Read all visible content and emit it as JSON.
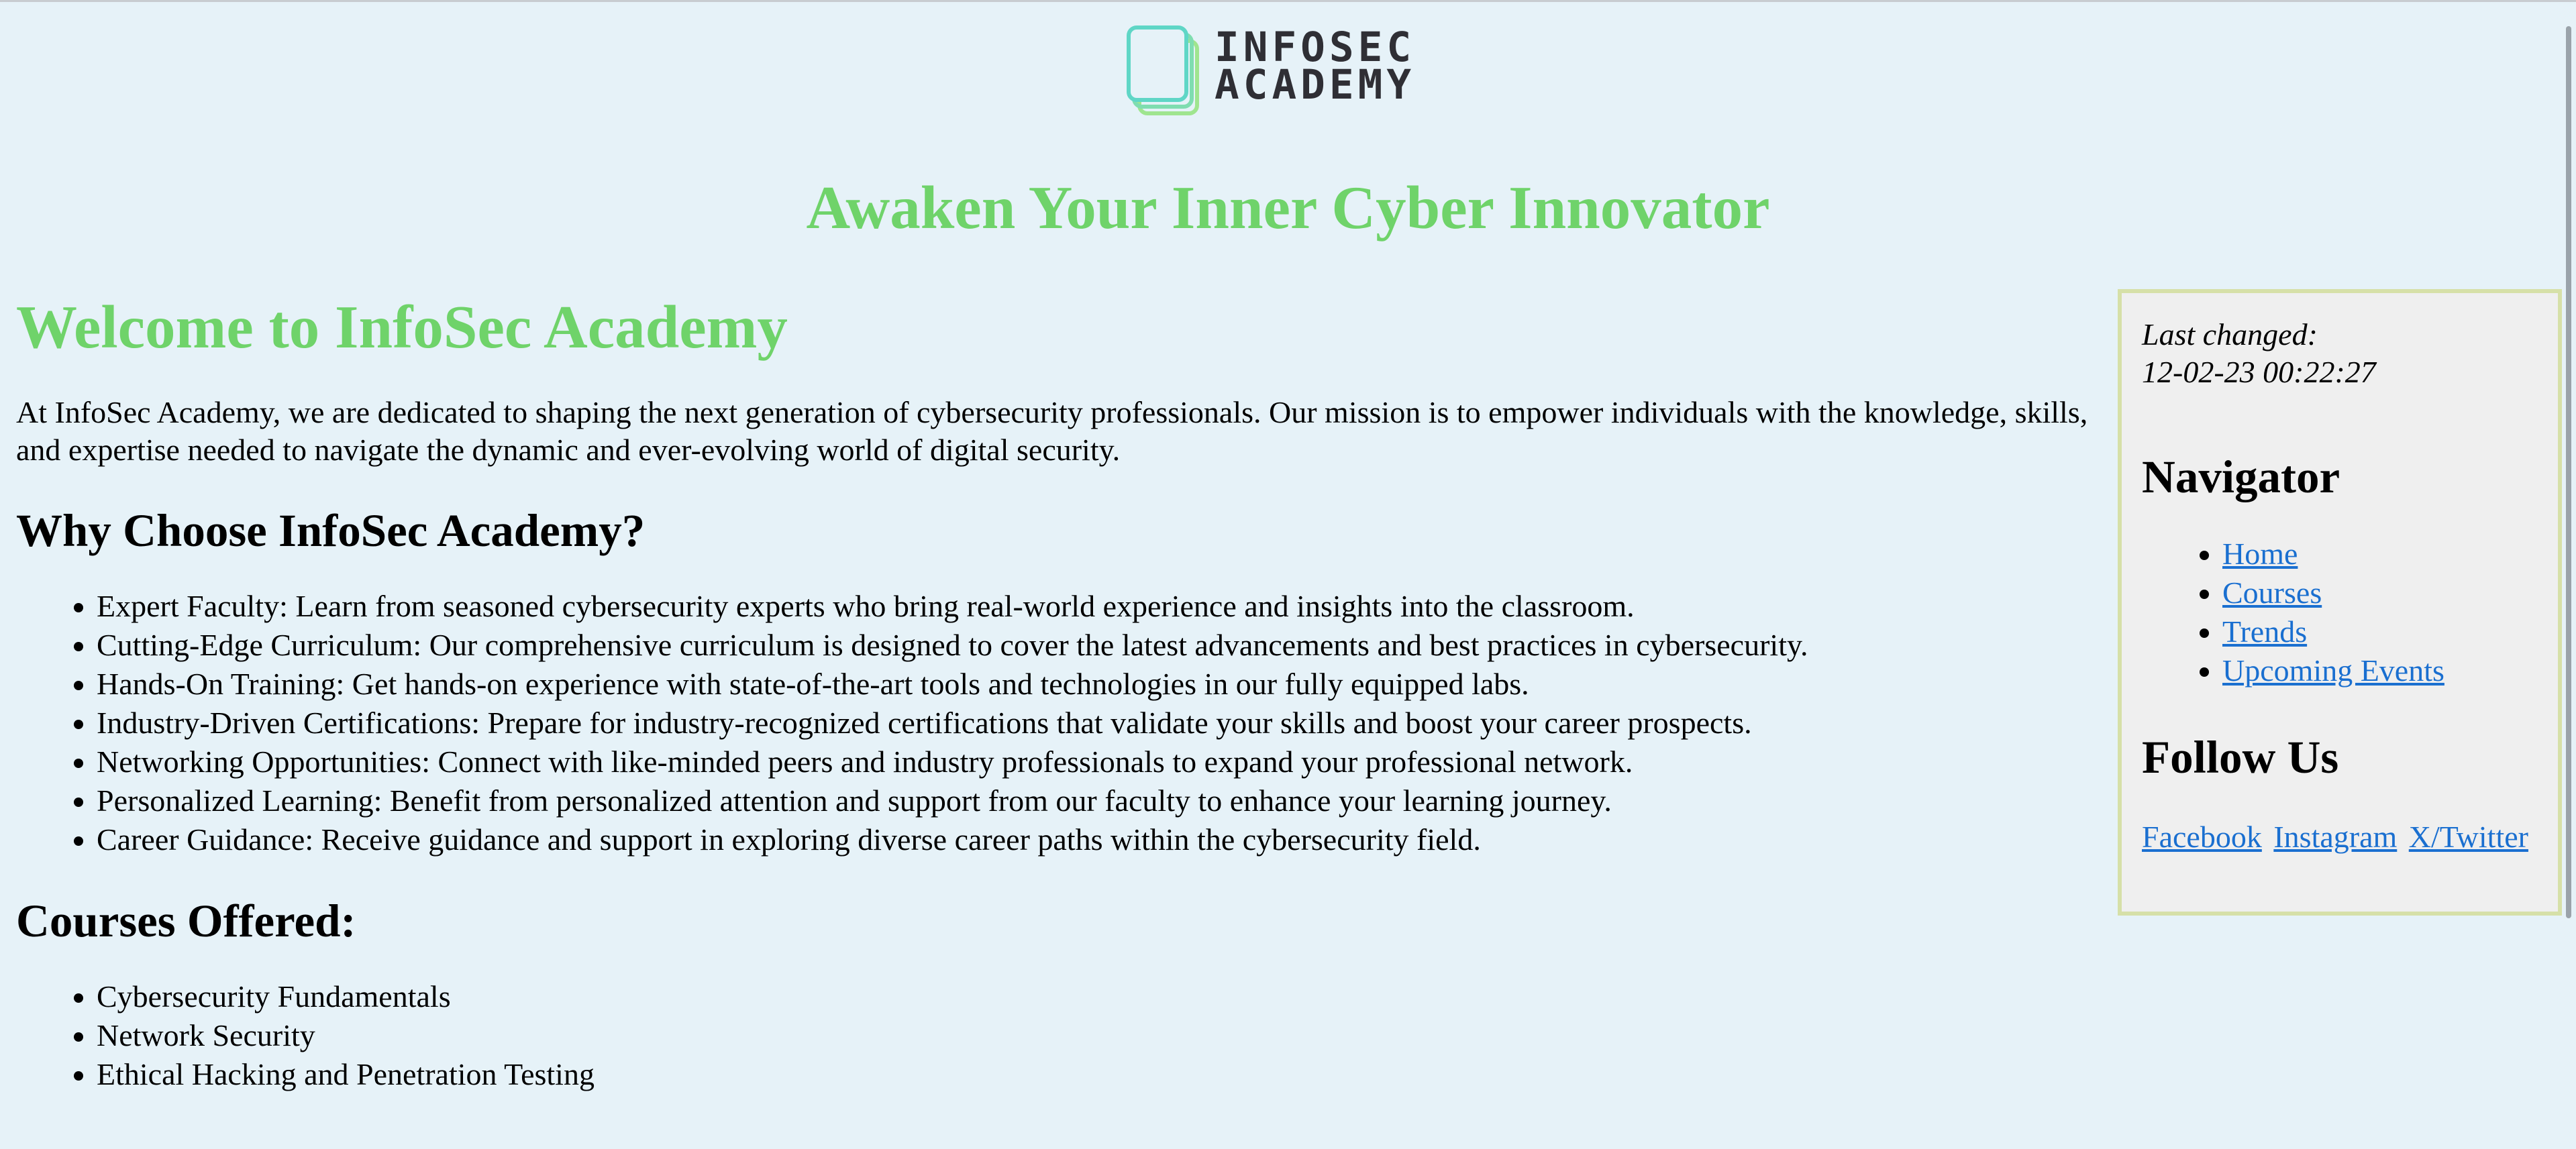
{
  "header": {
    "logo": {
      "line1": "INFOSEC",
      "line2": "ACADEMY",
      "accent_color": "#5fd6c6"
    },
    "tagline": "Awaken Your Inner Cyber Innovator"
  },
  "main": {
    "title": "Welcome to InfoSec Academy",
    "intro": "At InfoSec Academy, we are dedicated to shaping the next generation of cybersecurity professionals. Our mission is to empower individuals with the knowledge, skills, and expertise needed to navigate the dynamic and ever-evolving world of digital security.",
    "why_heading": "Why Choose InfoSec Academy?",
    "why_items": [
      "Expert Faculty: Learn from seasoned cybersecurity experts who bring real-world experience and insights into the classroom.",
      "Cutting-Edge Curriculum: Our comprehensive curriculum is designed to cover the latest advancements and best practices in cybersecurity.",
      "Hands-On Training: Get hands-on experience with state-of-the-art tools and technologies in our fully equipped labs.",
      "Industry-Driven Certifications: Prepare for industry-recognized certifications that validate your skills and boost your career prospects.",
      "Networking Opportunities: Connect with like-minded peers and industry professionals to expand your professional network.",
      "Personalized Learning: Benefit from personalized attention and support from our faculty to enhance your learning journey.",
      "Career Guidance: Receive guidance and support in exploring diverse career paths within the cybersecurity field."
    ],
    "courses_heading": "Courses Offered:",
    "courses": [
      "Cybersecurity Fundamentals",
      "Network Security",
      "Ethical Hacking and Penetration Testing"
    ]
  },
  "sidebar": {
    "last_changed_label": "Last changed:",
    "last_changed_value": "12-02-23 00:22:27",
    "nav_heading": "Navigator",
    "nav_links": [
      "Home",
      "Courses",
      "Trends",
      "Upcoming Events"
    ],
    "follow_heading": "Follow Us",
    "social_links": [
      "Facebook",
      "Instagram",
      "X/Twitter"
    ]
  },
  "colors": {
    "background": "#e6f2f8",
    "heading_green": "#6fd36a",
    "link_blue": "#1a6fd0",
    "sidebar_bg": "#efefef",
    "sidebar_border": "#d6e0a8"
  }
}
